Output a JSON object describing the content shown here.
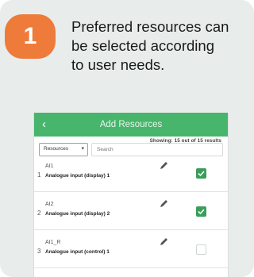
{
  "step": {
    "number": "1"
  },
  "caption": "Preferred resources can be selected according to user needs.",
  "app": {
    "title": "Add Resources",
    "filter": {
      "selected": "Resources"
    },
    "search": {
      "placeholder": "Search"
    },
    "showing": "Showing: 15 out of 15 results",
    "items": [
      {
        "index": "1",
        "name": "AI1",
        "desc": "Analogue input (display) 1",
        "checked": true
      },
      {
        "index": "2",
        "name": "AI2",
        "desc": "Analogue input (display) 2",
        "checked": true
      },
      {
        "index": "3",
        "name": "AI1_R",
        "desc": "Analogue input (control) 1",
        "checked": false
      }
    ]
  },
  "colors": {
    "accent": "#47b56b",
    "badge": "#ee7b3a",
    "check": "#3a9e5a",
    "card": "#e8edec"
  },
  "icons": {
    "back": "back-arrow-icon",
    "edit": "pencil-icon",
    "dropdown": "chevron-down-icon",
    "check": "checkmark-icon"
  }
}
